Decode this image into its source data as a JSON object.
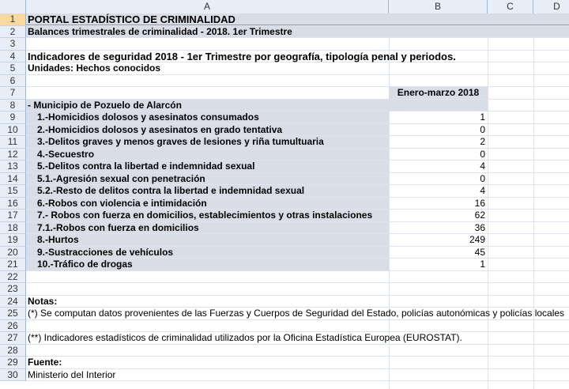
{
  "columns": [
    "A",
    "B",
    "C",
    "D"
  ],
  "rows": [
    {
      "n": "1",
      "a": "PORTAL ESTADÍSTICO DE CRIMINALIDAD",
      "b": "",
      "style": "title"
    },
    {
      "n": "2",
      "a": "Balances trimestrales de criminalidad - 2018. 1er Trimestre",
      "b": "",
      "style": "sub"
    },
    {
      "n": "3",
      "a": "",
      "b": "",
      "style": ""
    },
    {
      "n": "4",
      "a": "Indicadores de seguridad 2018 - 1er Trimestre por geografía,  tipología penal y periodos.",
      "b": "",
      "style": "big"
    },
    {
      "n": "5",
      "a": "Unidades: Hechos conocidos",
      "b": "",
      "style": "bold"
    },
    {
      "n": "6",
      "a": "",
      "b": "",
      "style": ""
    },
    {
      "n": "7",
      "a": "",
      "b": "Enero-marzo 2018",
      "style": "header"
    },
    {
      "n": "8",
      "a": "- Municipio de Pozuelo de Alarcón",
      "b": "",
      "style": "section"
    },
    {
      "n": "9",
      "a": "1.-Homicidios dolosos y asesinatos consumados",
      "b": "1",
      "style": "item"
    },
    {
      "n": "10",
      "a": "2.-Homicidios dolosos y asesinatos en grado tentativa",
      "b": "0",
      "style": "item"
    },
    {
      "n": "11",
      "a": "3.-Delitos graves y menos graves de lesiones y riña tumultuaria",
      "b": "2",
      "style": "item"
    },
    {
      "n": "12",
      "a": "4.-Secuestro",
      "b": "0",
      "style": "item"
    },
    {
      "n": "13",
      "a": "5.-Delitos contra la libertad e indemnidad sexual",
      "b": "4",
      "style": "item"
    },
    {
      "n": "14",
      "a": "5.1.-Agresión sexual con penetración",
      "b": "0",
      "style": "item"
    },
    {
      "n": "15",
      "a": "5.2.-Resto de delitos contra la libertad e indemnidad sexual",
      "b": "4",
      "style": "item"
    },
    {
      "n": "16",
      "a": "6.-Robos con violencia e intimidación",
      "b": "16",
      "style": "item"
    },
    {
      "n": "17",
      "a": "7.- Robos con fuerza en domicilios, establecimientos y otras instalaciones",
      "b": "62",
      "style": "item"
    },
    {
      "n": "18",
      "a": "7.1.-Robos con fuerza en domicilios",
      "b": "36",
      "style": "item"
    },
    {
      "n": "19",
      "a": "8.-Hurtos",
      "b": "249",
      "style": "item"
    },
    {
      "n": "20",
      "a": "9.-Sustracciones de vehículos",
      "b": "45",
      "style": "item"
    },
    {
      "n": "21",
      "a": "10.-Tráfico de drogas",
      "b": "1",
      "style": "item"
    },
    {
      "n": "22",
      "a": "",
      "b": "",
      "style": ""
    },
    {
      "n": "23",
      "a": "",
      "b": "",
      "style": ""
    },
    {
      "n": "24",
      "a": "Notas:",
      "b": "",
      "style": "bold"
    },
    {
      "n": "25",
      "a": "(*) Se computan datos provenientes de las Fuerzas y Cuerpos de  Seguridad del Estado, policías autonómicas y policías locales",
      "b": "",
      "style": "plain"
    },
    {
      "n": "26",
      "a": "",
      "b": "",
      "style": ""
    },
    {
      "n": "27",
      "a": " (**) Indicadores estadísticos de criminalidad utilizados por la  Oficina Estadística Europea (EUROSTAT).",
      "b": "",
      "style": "plain"
    },
    {
      "n": "28",
      "a": "",
      "b": "",
      "style": ""
    },
    {
      "n": "29",
      "a": "Fuente:",
      "b": "",
      "style": "bold"
    },
    {
      "n": "30",
      "a": "Ministerio del Interior",
      "b": "",
      "style": "plain"
    }
  ]
}
